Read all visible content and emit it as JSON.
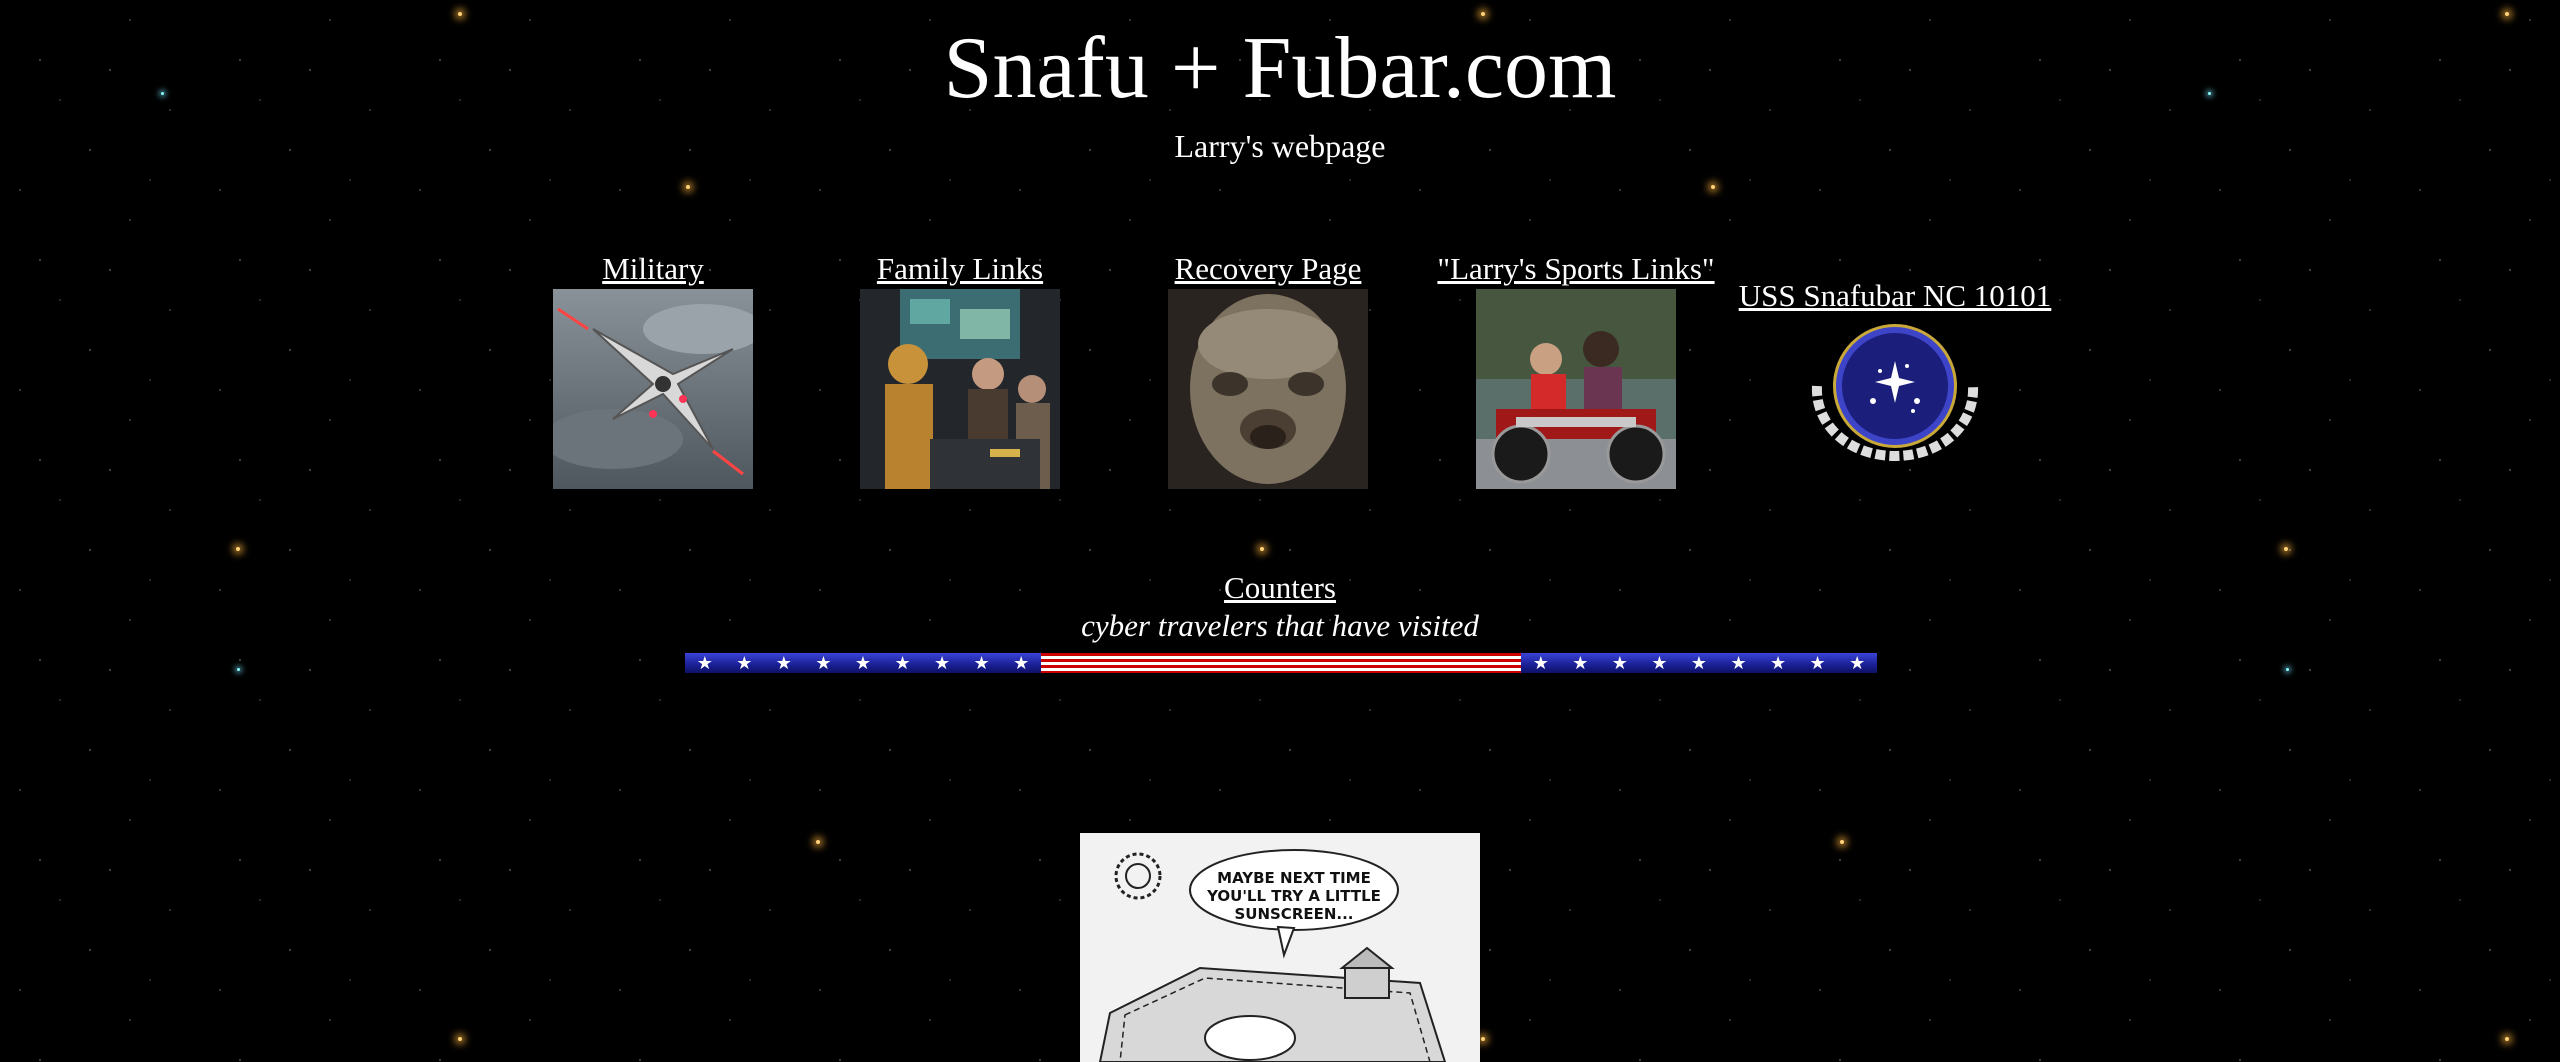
{
  "header": {
    "title": "Snafu + Fubar.com",
    "subtitle": "Larry's webpage"
  },
  "nav": [
    {
      "label": "Military",
      "icon": "x-wing-fighter-photo"
    },
    {
      "label": "Family Links",
      "icon": "droid-and-crew-photo"
    },
    {
      "label": "Recovery Page",
      "icon": "alien-face-photo"
    },
    {
      "label": "\"Larry's Sports Links\"",
      "icon": "motorcycle-riders-photo"
    },
    {
      "label": "USS Snafubar NC 10101",
      "icon": "federation-emblem"
    }
  ],
  "counters": {
    "link_label": "Counters",
    "caption": "cyber travelers that have visited"
  },
  "comic": {
    "speech": "MAYBE NEXT TIME YOU'LL TRY A LITTLE SUNSCREEN..."
  },
  "colors": {
    "background": "#000000",
    "text": "#ffffff",
    "flag_blue": "#1a1f95",
    "flag_red": "#cc0000"
  }
}
